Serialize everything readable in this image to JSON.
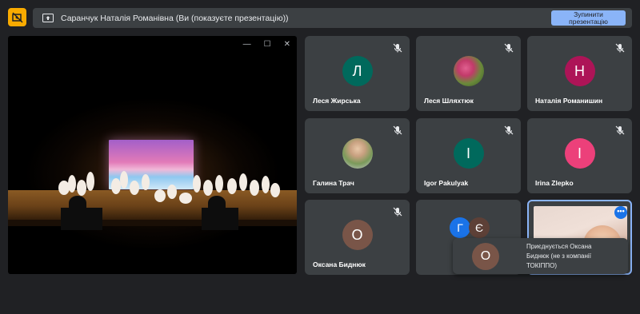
{
  "banner": {
    "text": "Саранчук Наталія Романівна (Ви (показуєте презентацію))",
    "stop_line1": "Зупинити",
    "stop_line2": "презентацію"
  },
  "presentation": {
    "window_controls": [
      "—",
      "☐",
      "✕"
    ]
  },
  "participants": [
    {
      "name": "Леся Жирська",
      "initial": "Л",
      "color": "#00695c",
      "muted": true
    },
    {
      "name": "Леся Шляхтюк",
      "initial": "",
      "photo": "flowers",
      "muted": true
    },
    {
      "name": "Наталія Романишин",
      "initial": "Н",
      "color": "#ad1457",
      "muted": true
    },
    {
      "name": "Галина Трач",
      "initial": "",
      "photo": "portrait",
      "muted": true
    },
    {
      "name": "Igor Pakulyak",
      "initial": "I",
      "color": "#00695c",
      "muted": true
    },
    {
      "name": "Irina Zlepko",
      "initial": "I",
      "color": "#ec407a",
      "muted": true
    },
    {
      "name": "Оксана Биднюк",
      "initial": "О",
      "color": "#795548",
      "muted": true
    },
    {
      "group": [
        "Г",
        "Є"
      ],
      "group_colors": [
        "#1a73e8",
        "#5d4037"
      ]
    },
    {
      "active": true,
      "more_label": "•••"
    }
  ],
  "toast": {
    "initial": "О",
    "text": "Приєднується Оксана Биднюк (не з компанії ТОКІППО)"
  },
  "colors": {
    "background": "#202124",
    "tile": "#3c4043",
    "accent": "#8ab4f8",
    "app_icon": "#f9ab00"
  }
}
